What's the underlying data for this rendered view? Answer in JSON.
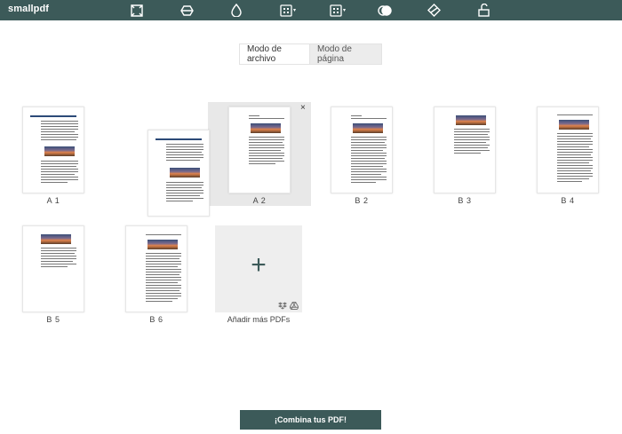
{
  "app": {
    "logo": "smallpdf"
  },
  "toolbar": {
    "tools": [
      {
        "icon": "compress-icon"
      },
      {
        "icon": "eraser-icon"
      },
      {
        "icon": "drop-icon"
      },
      {
        "icon": "grid-tool-icon",
        "has_menu": true
      },
      {
        "icon": "grid-tool-2-icon",
        "has_menu": true
      },
      {
        "icon": "merge-circles-icon"
      },
      {
        "icon": "sign-icon"
      },
      {
        "icon": "unlock-icon"
      }
    ]
  },
  "mode": {
    "file_mode": "Modo de archivo",
    "page_mode": "Modo de página",
    "selected": "Modo de archivo"
  },
  "pages": [
    {
      "label": "A 1",
      "heading": "LOREM IPSUM DOLOR SIT AMET"
    },
    {
      "label": "A 2",
      "selected": true
    },
    {
      "label": "B 2"
    },
    {
      "label": "B 3"
    },
    {
      "label": "B 4"
    },
    {
      "label": "B 5"
    },
    {
      "label": "B 6"
    }
  ],
  "dragging_page": {
    "heading": "LOREM IPSUM DOLOR SIT AMET"
  },
  "close_symbol": "×",
  "add_tile": {
    "plus": "+",
    "label": "Añadir más PDFs",
    "icons": [
      "dropbox-icon",
      "google-drive-icon"
    ]
  },
  "combine_button": "¡Combina tus PDF!",
  "colors": {
    "brand": "#3c5a59",
    "selected_bg": "#e8e8e8",
    "title_blue": "#2c4a78"
  }
}
